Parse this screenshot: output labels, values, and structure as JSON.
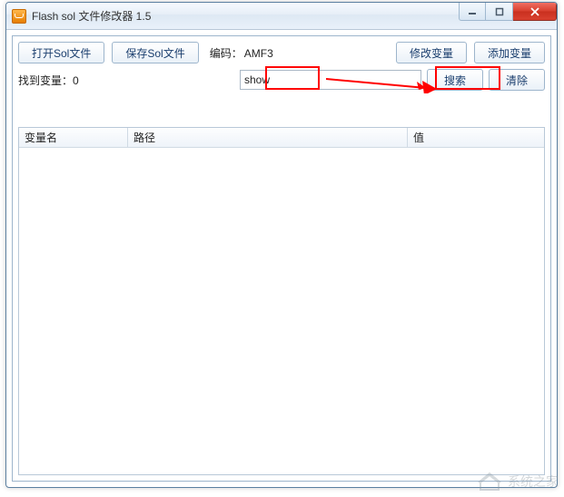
{
  "window": {
    "title": "Flash sol 文件修改器 1.5"
  },
  "toolbar": {
    "open_label": "打开Sol文件",
    "save_label": "保存Sol文件",
    "encoding_key": "编码：",
    "encoding_value": "AMF3",
    "modify_label": "修改变量",
    "add_label": "添加变量"
  },
  "search": {
    "found_key": "找到变量：",
    "found_count": "0",
    "input_value": "show",
    "search_label": "搜索",
    "clear_label": "清除"
  },
  "table": {
    "columns": [
      "变量名",
      "路径",
      "值"
    ],
    "rows": []
  },
  "watermark": {
    "text": "系统之家"
  }
}
